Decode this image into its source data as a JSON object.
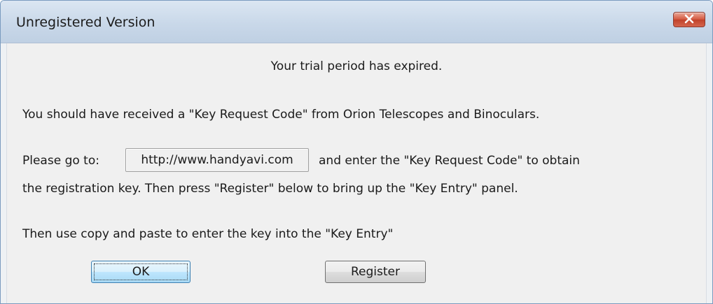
{
  "window": {
    "title": "Unregistered Version",
    "close_icon": "close-icon"
  },
  "message": {
    "trial_expired": "Your trial period has expired.",
    "key_request_info": "You should have received a \"Key Request Code\" from Orion Telescopes and Binoculars.",
    "go_to_prefix": "Please go to:",
    "url": "http://www.handyavi.com",
    "go_to_suffix": "and enter the \"Key Request Code\" to obtain",
    "registration_line": "the registration key.  Then press \"Register\" below to bring up the \"Key Entry\" panel.",
    "copy_paste_line": "Then use copy and paste to enter the key into the \"Key Entry\""
  },
  "buttons": {
    "ok_label": "OK",
    "register_label": "Register"
  },
  "colors": {
    "close_button": "#c0422a",
    "ok_button_accent": "#3c7fb1"
  }
}
